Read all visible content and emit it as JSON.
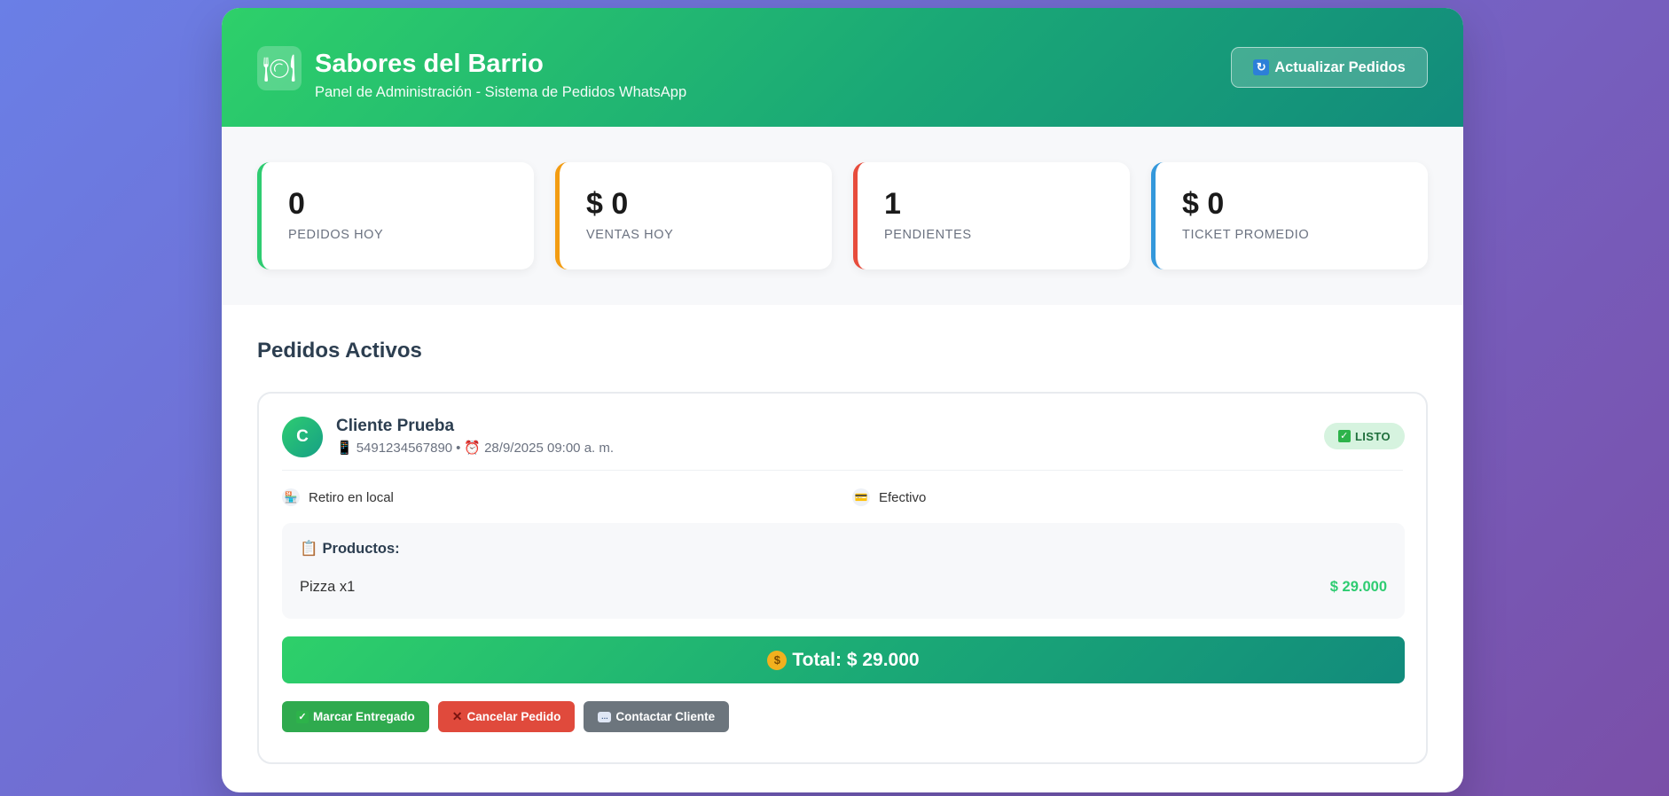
{
  "header": {
    "logo_icon": "🍽",
    "title": "Sabores del Barrio",
    "subtitle": "Panel de Administración - Sistema de Pedidos WhatsApp",
    "refresh_button": "Actualizar Pedidos",
    "refresh_icon": "↻"
  },
  "stats": [
    {
      "value": "0",
      "label": "PEDIDOS HOY",
      "color": "#2ecc71"
    },
    {
      "value": "$ 0",
      "label": "VENTAS HOY",
      "color": "#f39c12"
    },
    {
      "value": "1",
      "label": "PENDIENTES",
      "color": "#e74c3c"
    },
    {
      "value": "$ 0",
      "label": "TICKET PROMEDIO",
      "color": "#3498db"
    }
  ],
  "section_title": "Pedidos Activos",
  "order": {
    "avatar_letter": "C",
    "customer_name": "Cliente Prueba",
    "phone_icon": "📱",
    "phone": "5491234567890",
    "separator": "•",
    "clock_icon": "⏰",
    "datetime": "28/9/2025 09:00 a. m.",
    "status_badge": "LISTO",
    "delivery_icon": "🏪",
    "delivery": "Retiro en local",
    "payment_icon": "💳",
    "payment": "Efectivo",
    "products_icon": "📋",
    "products_title": "Productos:",
    "items": [
      {
        "name": "Pizza x1",
        "price": "$ 29.000"
      }
    ],
    "total": "Total: $ 29.000",
    "total_icon": "$",
    "actions": {
      "deliver": "Marcar Entregado",
      "cancel": "Cancelar Pedido",
      "contact": "Contactar Cliente"
    }
  }
}
